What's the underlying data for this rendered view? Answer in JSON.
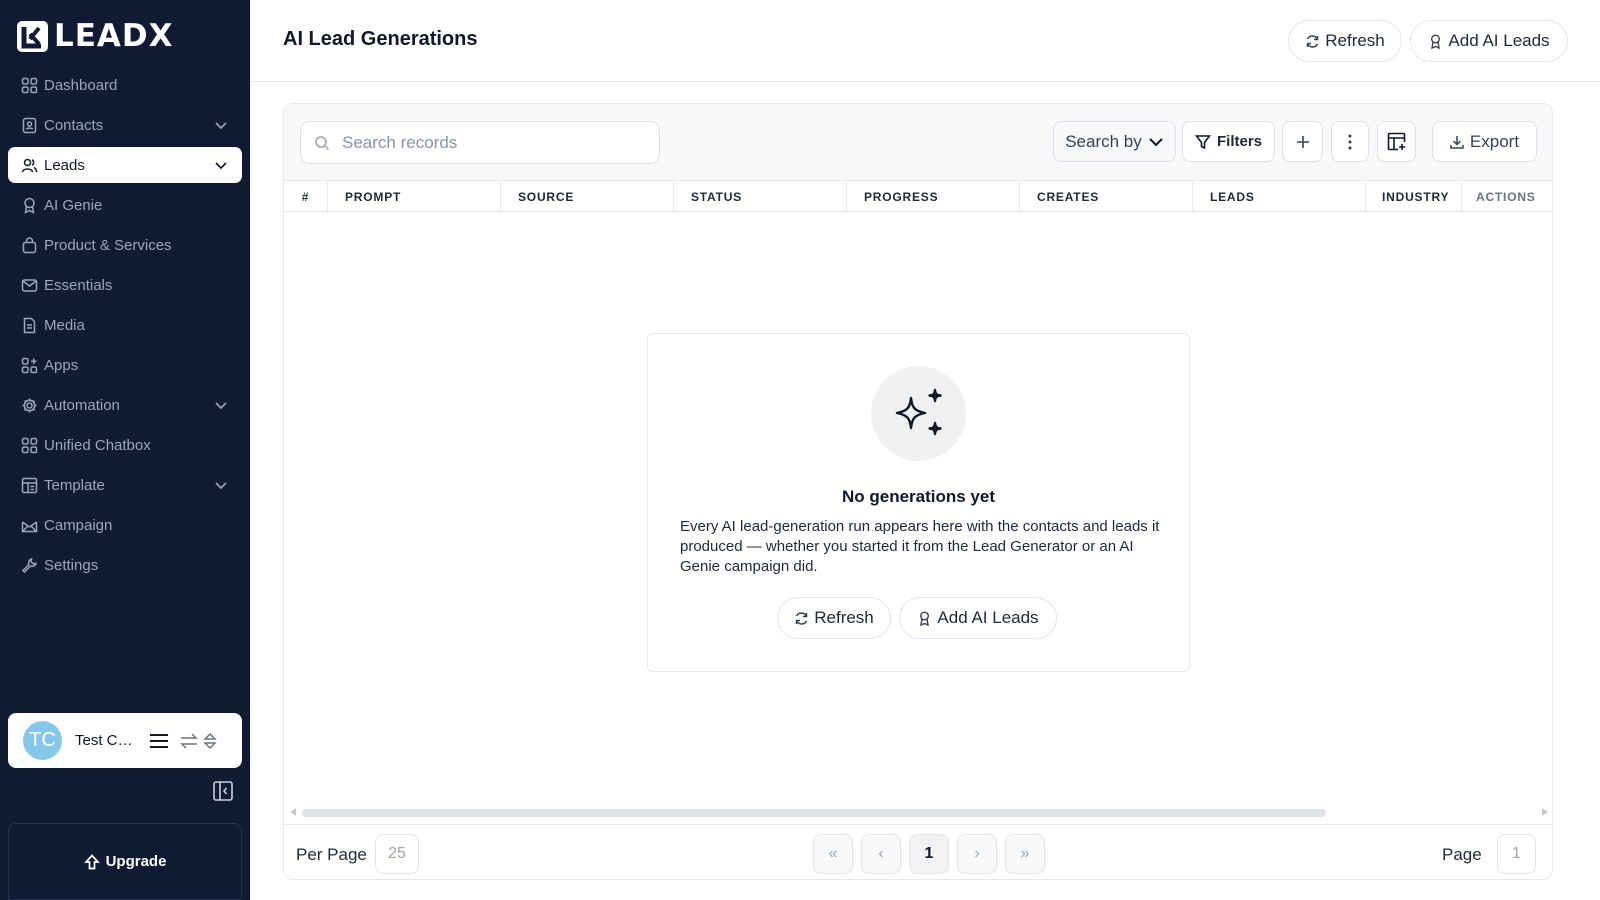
{
  "app": {
    "logo_text": "LEADX"
  },
  "sidebar": {
    "items": [
      {
        "label": "Dashboard"
      },
      {
        "label": "Contacts"
      },
      {
        "label": "Leads"
      },
      {
        "label": "AI Genie"
      },
      {
        "label": "Product & Services"
      },
      {
        "label": "Essentials"
      },
      {
        "label": "Media"
      },
      {
        "label": "Apps"
      },
      {
        "label": "Automation"
      },
      {
        "label": "Unified Chatbox"
      },
      {
        "label": "Template"
      },
      {
        "label": "Campaign"
      },
      {
        "label": "Settings"
      }
    ],
    "active": "Leads",
    "user": {
      "initials": "TC",
      "name": "Test Co...",
      "avatar_color": "#87c7ea"
    },
    "upgrade_label": "Upgrade"
  },
  "header": {
    "title": "AI Lead Generations",
    "refresh_label": "Refresh",
    "add_label": "Add AI Leads"
  },
  "toolbar": {
    "search_placeholder": "Search records",
    "search_by_label": "Search by",
    "filters_label": "Filters",
    "export_label": "Export"
  },
  "table": {
    "columns": [
      "#",
      "PROMPT",
      "SOURCE",
      "STATUS",
      "PROGRESS",
      "CREATES",
      "LEADS",
      "INDUSTRY",
      "ACTIONS"
    ]
  },
  "empty_state": {
    "title": "No generations yet",
    "description": "Every AI lead-generation run appears here with the contacts and leads it produced — whether you started it from the Lead Generator or an AI Genie campaign did.",
    "refresh_label": "Refresh",
    "add_label": "Add AI Leads"
  },
  "pagination": {
    "per_page_label": "Per Page",
    "per_page_value": "25",
    "current_page": "1",
    "page_label": "Page",
    "page_value": "1",
    "first_symbol": "«",
    "prev_symbol": "‹",
    "next_symbol": "›",
    "last_symbol": "»"
  },
  "colors": {
    "sidebar_bg": "#101b33",
    "accent": "#111827"
  }
}
